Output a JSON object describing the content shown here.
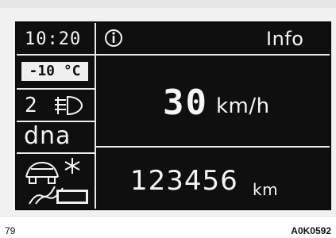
{
  "page": {
    "figure_number": "79",
    "figure_code": "A0K0592"
  },
  "display": {
    "time": "10:20",
    "info_label": "Info",
    "info_icon": "info-icon",
    "outside_temp": "-10 °C",
    "headlight_level": "2",
    "headlight_icon": "headlight-levelling-icon",
    "drive_mode": "dna",
    "speed_value": "30",
    "speed_unit": "km/h",
    "odometer_value": "123456",
    "odometer_unit": "km",
    "warning_icons": [
      "car-ice-icon",
      "snowflake-icon",
      "slippery-road-icon"
    ]
  },
  "colors": {
    "lcd_background": "#0f0f0f",
    "lcd_foreground": "#f5f5f5",
    "frame": "#f1f1f1"
  }
}
